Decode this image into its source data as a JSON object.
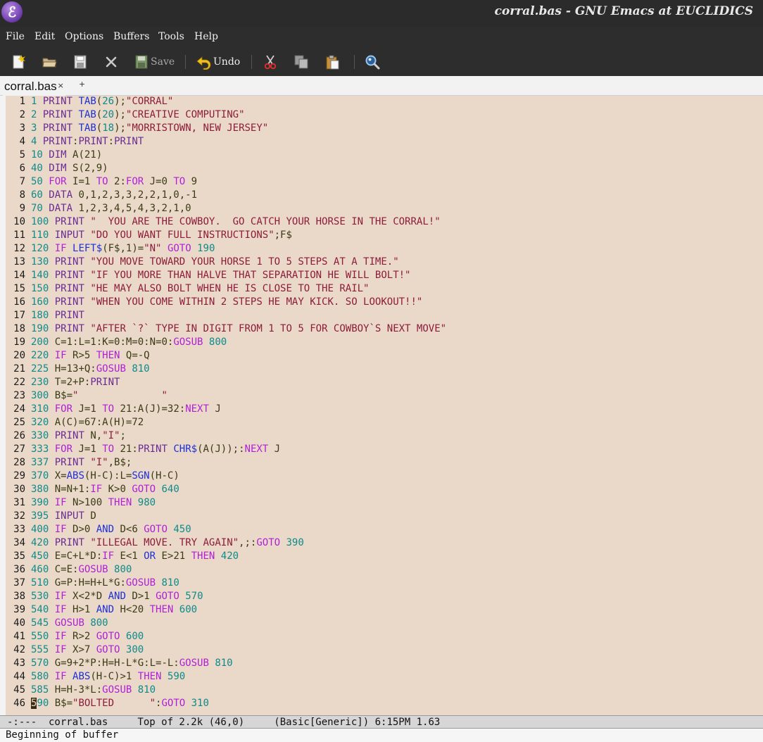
{
  "window": {
    "title": "corral.bas - GNU Emacs at EUCLIDICS",
    "logo_glyph": "ℰ"
  },
  "menu": [
    "File",
    "Edit",
    "Options",
    "Buffers",
    "Tools",
    "Help"
  ],
  "toolbar": {
    "save_label": "Save",
    "undo_label": "Undo",
    "icons": [
      "new-file-icon",
      "open-folder-icon",
      "save-document-icon",
      "close-x-icon",
      "save-icon",
      "undo-icon",
      "cut-icon",
      "copy-icon",
      "paste-icon",
      "search-icon"
    ]
  },
  "tabs": {
    "active_label": "corral.bas",
    "close_glyph": "×",
    "new_glyph": "+"
  },
  "colors": {
    "keyword": "#6a2a94",
    "function": "#1d2fd6",
    "string": "#8c1c3a",
    "number": "#0e8a8a",
    "control": "#b01fd6",
    "background": "#ead9c9"
  },
  "code_lines": [
    [
      [
        "n",
        "1"
      ],
      [
        "t",
        " "
      ],
      [
        "k",
        "PRINT"
      ],
      [
        "t",
        " "
      ],
      [
        "f",
        "TAB"
      ],
      [
        "t",
        "("
      ],
      [
        "n",
        "26"
      ],
      [
        "t",
        ");"
      ],
      [
        "s",
        "\"CORRAL\""
      ]
    ],
    [
      [
        "n",
        "2"
      ],
      [
        "t",
        " "
      ],
      [
        "k",
        "PRINT"
      ],
      [
        "t",
        " "
      ],
      [
        "f",
        "TAB"
      ],
      [
        "t",
        "("
      ],
      [
        "n",
        "20"
      ],
      [
        "t",
        ");"
      ],
      [
        "s",
        "\"CREATIVE COMPUTING\""
      ]
    ],
    [
      [
        "n",
        "3"
      ],
      [
        "t",
        " "
      ],
      [
        "k",
        "PRINT"
      ],
      [
        "t",
        " "
      ],
      [
        "f",
        "TAB"
      ],
      [
        "t",
        "("
      ],
      [
        "n",
        "18"
      ],
      [
        "t",
        ");"
      ],
      [
        "s",
        "\"MORRISTOWN, NEW JERSEY\""
      ]
    ],
    [
      [
        "n",
        "4"
      ],
      [
        "t",
        " "
      ],
      [
        "k",
        "PRINT"
      ],
      [
        "t",
        ":"
      ],
      [
        "k",
        "PRINT"
      ],
      [
        "t",
        ":"
      ],
      [
        "k",
        "PRINT"
      ]
    ],
    [
      [
        "n",
        "10"
      ],
      [
        "t",
        " "
      ],
      [
        "k",
        "DIM"
      ],
      [
        "t",
        " A(21)"
      ]
    ],
    [
      [
        "n",
        "40"
      ],
      [
        "t",
        " "
      ],
      [
        "k",
        "DIM"
      ],
      [
        "t",
        " S(2,9)"
      ]
    ],
    [
      [
        "n",
        "50"
      ],
      [
        "t",
        " "
      ],
      [
        "o",
        "FOR"
      ],
      [
        "t",
        " I=1 "
      ],
      [
        "o",
        "TO"
      ],
      [
        "t",
        " 2:"
      ],
      [
        "o",
        "FOR"
      ],
      [
        "t",
        " J=0 "
      ],
      [
        "o",
        "TO"
      ],
      [
        "t",
        " 9"
      ]
    ],
    [
      [
        "n",
        "60"
      ],
      [
        "t",
        " "
      ],
      [
        "k",
        "DATA"
      ],
      [
        "t",
        " 0,1,2,3,3,2,2,1,0,-1"
      ]
    ],
    [
      [
        "n",
        "70"
      ],
      [
        "t",
        " "
      ],
      [
        "k",
        "DATA"
      ],
      [
        "t",
        " 1,2,3,4,5,4,3,2,1,0"
      ]
    ],
    [
      [
        "n",
        "100"
      ],
      [
        "t",
        " "
      ],
      [
        "k",
        "PRINT"
      ],
      [
        "t",
        " "
      ],
      [
        "s",
        "\"  YOU ARE THE COWBOY.  GO CATCH YOUR HORSE IN THE CORRAL!\""
      ]
    ],
    [
      [
        "n",
        "110"
      ],
      [
        "t",
        " "
      ],
      [
        "k",
        "INPUT"
      ],
      [
        "t",
        " "
      ],
      [
        "s",
        "\"DO YOU WANT FULL INSTRUCTIONS\""
      ],
      [
        "t",
        ";F$"
      ]
    ],
    [
      [
        "n",
        "120"
      ],
      [
        "t",
        " "
      ],
      [
        "o",
        "IF"
      ],
      [
        "t",
        " "
      ],
      [
        "f",
        "LEFT$"
      ],
      [
        "t",
        "(F$,1)="
      ],
      [
        "s",
        "\"N\""
      ],
      [
        "t",
        " "
      ],
      [
        "o",
        "GOTO"
      ],
      [
        "t",
        " "
      ],
      [
        "n",
        "190"
      ]
    ],
    [
      [
        "n",
        "130"
      ],
      [
        "t",
        " "
      ],
      [
        "k",
        "PRINT"
      ],
      [
        "t",
        " "
      ],
      [
        "s",
        "\"YOU MOVE TOWARD YOUR HORSE 1 TO 5 STEPS AT A TIME.\""
      ]
    ],
    [
      [
        "n",
        "140"
      ],
      [
        "t",
        " "
      ],
      [
        "k",
        "PRINT"
      ],
      [
        "t",
        " "
      ],
      [
        "s",
        "\"IF YOU MORE THAN HALVE THAT SEPARATION HE WILL BOLT!\""
      ]
    ],
    [
      [
        "n",
        "150"
      ],
      [
        "t",
        " "
      ],
      [
        "k",
        "PRINT"
      ],
      [
        "t",
        " "
      ],
      [
        "s",
        "\"HE MAY ALSO BOLT WHEN HE IS CLOSE TO THE RAIL\""
      ]
    ],
    [
      [
        "n",
        "160"
      ],
      [
        "t",
        " "
      ],
      [
        "k",
        "PRINT"
      ],
      [
        "t",
        " "
      ],
      [
        "s",
        "\"WHEN YOU COME WITHIN 2 STEPS HE MAY KICK. SO LOOKOUT!!\""
      ]
    ],
    [
      [
        "n",
        "180"
      ],
      [
        "t",
        " "
      ],
      [
        "k",
        "PRINT"
      ]
    ],
    [
      [
        "n",
        "190"
      ],
      [
        "t",
        " "
      ],
      [
        "k",
        "PRINT"
      ],
      [
        "t",
        " "
      ],
      [
        "s",
        "\"AFTER `?` TYPE IN DIGIT FROM 1 TO 5 FOR COWBOY`S NEXT MOVE\""
      ]
    ],
    [
      [
        "n",
        "200"
      ],
      [
        "t",
        " C=1:L=1:K=0:M=0:N=0:"
      ],
      [
        "o",
        "GOSUB"
      ],
      [
        "t",
        " "
      ],
      [
        "n",
        "800"
      ]
    ],
    [
      [
        "n",
        "220"
      ],
      [
        "t",
        " "
      ],
      [
        "o",
        "IF"
      ],
      [
        "t",
        " R>5 "
      ],
      [
        "o",
        "THEN"
      ],
      [
        "t",
        " Q=-Q"
      ]
    ],
    [
      [
        "n",
        "225"
      ],
      [
        "t",
        " H=13+Q:"
      ],
      [
        "o",
        "GOSUB"
      ],
      [
        "t",
        " "
      ],
      [
        "n",
        "810"
      ]
    ],
    [
      [
        "n",
        "230"
      ],
      [
        "t",
        " T=2+P:"
      ],
      [
        "k",
        "PRINT"
      ]
    ],
    [
      [
        "n",
        "300"
      ],
      [
        "t",
        " B$="
      ],
      [
        "s",
        "\"              \""
      ]
    ],
    [
      [
        "n",
        "310"
      ],
      [
        "t",
        " "
      ],
      [
        "o",
        "FOR"
      ],
      [
        "t",
        " J=1 "
      ],
      [
        "o",
        "TO"
      ],
      [
        "t",
        " 21:A(J)=32:"
      ],
      [
        "o",
        "NEXT"
      ],
      [
        "t",
        " J"
      ]
    ],
    [
      [
        "n",
        "320"
      ],
      [
        "t",
        " A(C)=67:A(H)=72"
      ]
    ],
    [
      [
        "n",
        "330"
      ],
      [
        "t",
        " "
      ],
      [
        "k",
        "PRINT"
      ],
      [
        "t",
        " N,"
      ],
      [
        "s",
        "\"I\""
      ],
      [
        "t",
        ";"
      ]
    ],
    [
      [
        "n",
        "333"
      ],
      [
        "t",
        " "
      ],
      [
        "o",
        "FOR"
      ],
      [
        "t",
        " J=1 "
      ],
      [
        "o",
        "TO"
      ],
      [
        "t",
        " 21:"
      ],
      [
        "k",
        "PRINT"
      ],
      [
        "t",
        " "
      ],
      [
        "f",
        "CHR$"
      ],
      [
        "t",
        "(A(J));:"
      ],
      [
        "o",
        "NEXT"
      ],
      [
        "t",
        " J"
      ]
    ],
    [
      [
        "n",
        "337"
      ],
      [
        "t",
        " "
      ],
      [
        "k",
        "PRINT"
      ],
      [
        "t",
        " "
      ],
      [
        "s",
        "\"I\""
      ],
      [
        "t",
        ",B$;"
      ]
    ],
    [
      [
        "n",
        "370"
      ],
      [
        "t",
        " X="
      ],
      [
        "f",
        "ABS"
      ],
      [
        "t",
        "(H-C):L="
      ],
      [
        "f",
        "SGN"
      ],
      [
        "t",
        "(H-C)"
      ]
    ],
    [
      [
        "n",
        "380"
      ],
      [
        "t",
        " N=N+1:"
      ],
      [
        "o",
        "IF"
      ],
      [
        "t",
        " K>0 "
      ],
      [
        "o",
        "GOTO"
      ],
      [
        "t",
        " "
      ],
      [
        "n",
        "640"
      ]
    ],
    [
      [
        "n",
        "390"
      ],
      [
        "t",
        " "
      ],
      [
        "o",
        "IF"
      ],
      [
        "t",
        " N>100 "
      ],
      [
        "o",
        "THEN"
      ],
      [
        "t",
        " "
      ],
      [
        "n",
        "980"
      ]
    ],
    [
      [
        "n",
        "395"
      ],
      [
        "t",
        " "
      ],
      [
        "k",
        "INPUT"
      ],
      [
        "t",
        " D"
      ]
    ],
    [
      [
        "n",
        "400"
      ],
      [
        "t",
        " "
      ],
      [
        "o",
        "IF"
      ],
      [
        "t",
        " D>0 "
      ],
      [
        "f",
        "AND"
      ],
      [
        "t",
        " D<6 "
      ],
      [
        "o",
        "GOTO"
      ],
      [
        "t",
        " "
      ],
      [
        "n",
        "450"
      ]
    ],
    [
      [
        "n",
        "420"
      ],
      [
        "t",
        " "
      ],
      [
        "k",
        "PRINT"
      ],
      [
        "t",
        " "
      ],
      [
        "s",
        "\"ILLEGAL MOVE. TRY AGAIN\""
      ],
      [
        "t",
        ",;:"
      ],
      [
        "o",
        "GOTO"
      ],
      [
        "t",
        " "
      ],
      [
        "n",
        "390"
      ]
    ],
    [
      [
        "n",
        "450"
      ],
      [
        "t",
        " E=C+L*D:"
      ],
      [
        "o",
        "IF"
      ],
      [
        "t",
        " E<1 "
      ],
      [
        "f",
        "OR"
      ],
      [
        "t",
        " E>21 "
      ],
      [
        "o",
        "THEN"
      ],
      [
        "t",
        " "
      ],
      [
        "n",
        "420"
      ]
    ],
    [
      [
        "n",
        "460"
      ],
      [
        "t",
        " C=E:"
      ],
      [
        "o",
        "GOSUB"
      ],
      [
        "t",
        " "
      ],
      [
        "n",
        "800"
      ]
    ],
    [
      [
        "n",
        "510"
      ],
      [
        "t",
        " G=P:H=H+L*G:"
      ],
      [
        "o",
        "GOSUB"
      ],
      [
        "t",
        " "
      ],
      [
        "n",
        "810"
      ]
    ],
    [
      [
        "n",
        "530"
      ],
      [
        "t",
        " "
      ],
      [
        "o",
        "IF"
      ],
      [
        "t",
        " X<2*D "
      ],
      [
        "f",
        "AND"
      ],
      [
        "t",
        " D>1 "
      ],
      [
        "o",
        "GOTO"
      ],
      [
        "t",
        " "
      ],
      [
        "n",
        "570"
      ]
    ],
    [
      [
        "n",
        "540"
      ],
      [
        "t",
        " "
      ],
      [
        "o",
        "IF"
      ],
      [
        "t",
        " H>1 "
      ],
      [
        "f",
        "AND"
      ],
      [
        "t",
        " H<20 "
      ],
      [
        "o",
        "THEN"
      ],
      [
        "t",
        " "
      ],
      [
        "n",
        "600"
      ]
    ],
    [
      [
        "n",
        "545"
      ],
      [
        "t",
        " "
      ],
      [
        "o",
        "GOSUB"
      ],
      [
        "t",
        " "
      ],
      [
        "n",
        "800"
      ]
    ],
    [
      [
        "n",
        "550"
      ],
      [
        "t",
        " "
      ],
      [
        "o",
        "IF"
      ],
      [
        "t",
        " R>2 "
      ],
      [
        "o",
        "GOTO"
      ],
      [
        "t",
        " "
      ],
      [
        "n",
        "600"
      ]
    ],
    [
      [
        "n",
        "555"
      ],
      [
        "t",
        " "
      ],
      [
        "o",
        "IF"
      ],
      [
        "t",
        " X>7 "
      ],
      [
        "o",
        "GOTO"
      ],
      [
        "t",
        " "
      ],
      [
        "n",
        "300"
      ]
    ],
    [
      [
        "n",
        "570"
      ],
      [
        "t",
        " G=9+2*P:H=H-L*G:L=-L:"
      ],
      [
        "o",
        "GOSUB"
      ],
      [
        "t",
        " "
      ],
      [
        "n",
        "810"
      ]
    ],
    [
      [
        "n",
        "580"
      ],
      [
        "t",
        " "
      ],
      [
        "o",
        "IF"
      ],
      [
        "t",
        " "
      ],
      [
        "f",
        "ABS"
      ],
      [
        "t",
        "(H-C)>1 "
      ],
      [
        "o",
        "THEN"
      ],
      [
        "t",
        " "
      ],
      [
        "n",
        "590"
      ]
    ],
    [
      [
        "n",
        "585"
      ],
      [
        "t",
        " H=H-3*L:"
      ],
      [
        "o",
        "GOSUB"
      ],
      [
        "t",
        " "
      ],
      [
        "n",
        "810"
      ]
    ],
    [
      [
        "c",
        "5"
      ],
      [
        "n",
        "90"
      ],
      [
        "t",
        " B$="
      ],
      [
        "s",
        "\"BOLTED      \""
      ],
      [
        "t",
        ":"
      ],
      [
        "o",
        "GOTO"
      ],
      [
        "t",
        " "
      ],
      [
        "n",
        "310"
      ]
    ]
  ],
  "modeline": "-:---  corral.bas     Top of 2.2k (46,0)     (Basic[Generic]) 6:15PM 1.63",
  "echo_area": "Beginning of buffer"
}
